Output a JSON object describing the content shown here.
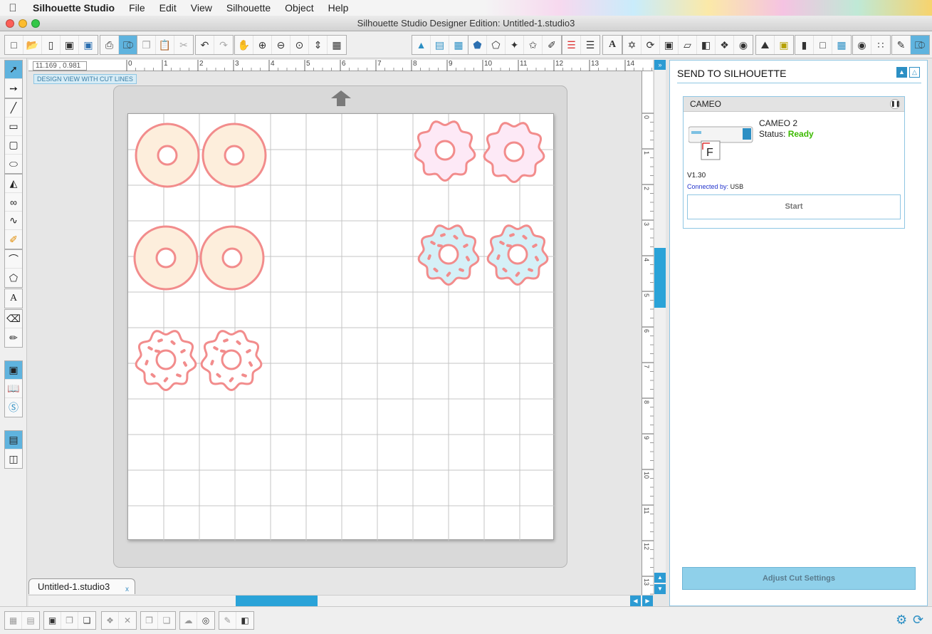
{
  "menubar": {
    "app": "Silhouette Studio",
    "items": [
      "File",
      "Edit",
      "View",
      "Silhouette",
      "Object",
      "Help"
    ]
  },
  "window": {
    "title": "Silhouette Studio Designer Edition: Untitled-1.studio3"
  },
  "toolbar": {
    "icons": [
      "new-file-icon",
      "open-file-icon",
      "library-icon",
      "save-icon",
      "save-library-icon",
      "print-icon",
      "send-to-silhouette-icon",
      "copy-icon",
      "paste-icon",
      "cut-icon",
      "undo-icon",
      "redo-icon",
      "pan-icon",
      "zoom-in-icon",
      "zoom-out-icon",
      "zoom-select-icon",
      "drag-zoom-icon",
      "fit-page-icon",
      "fill-color-icon",
      "gradient-icon",
      "pattern-icon",
      "line-color-icon",
      "line-style-icon",
      "sketch-icon",
      "eraser-icon",
      "text-style-icon",
      "transform-icon",
      "rotate-icon",
      "scale-icon",
      "shear-icon",
      "align-icon",
      "replicate-icon",
      "modify-icon",
      "offset-icon",
      "trace-icon",
      "page-setup-icon",
      "cut-settings-icon",
      "grid-icon",
      "registration-icon",
      "library-store-icon",
      "send-panel-icon"
    ]
  },
  "ruler": {
    "coordinates": "11.169 , 0.981",
    "h_ticks": [
      "0",
      "1",
      "2",
      "3",
      "4",
      "5",
      "6",
      "7",
      "8",
      "9",
      "10",
      "11",
      "12",
      "13",
      "14"
    ],
    "v_ticks": [
      "0",
      "1",
      "2",
      "3",
      "4",
      "5",
      "6",
      "7",
      "8",
      "9",
      "10",
      "11",
      "12",
      "13"
    ]
  },
  "canvas": {
    "view_label": "DESIGN VIEW WITH CUT LINES"
  },
  "document_tab": {
    "name": "Untitled-1.studio3",
    "close": "x"
  },
  "send_panel": {
    "title": "SEND TO SILHOUETTE",
    "device_header": "CAMEO",
    "device_name": "CAMEO 2",
    "status_label": "Status:",
    "status_value": "Ready",
    "firmware": "V1.30",
    "connected_label": "Connected by:",
    "connected_value": "USB",
    "start_label": "Start",
    "adjust_label": "Adjust Cut Settings"
  },
  "colors": {
    "accent": "#5fb3de",
    "status_ready": "#3cba00",
    "donut_outline": "#f28c8c",
    "cream_fill": "#fdeedc",
    "pink_fill": "#fde9f6",
    "blue_fill": "#d5f0f7",
    "sprinkle": "#f28c8c"
  }
}
